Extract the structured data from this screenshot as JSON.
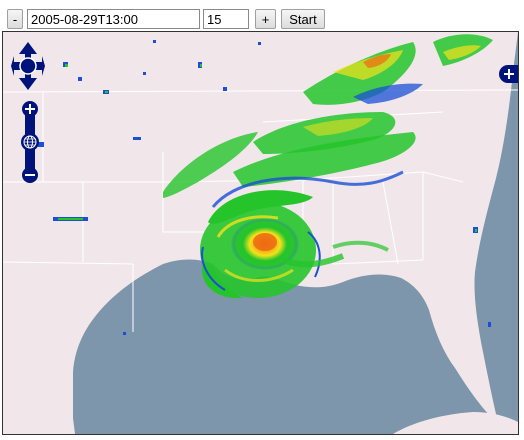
{
  "toolbar": {
    "step_back_label": "-",
    "time_value": "2005-08-29T13:00",
    "step_minutes_value": "15",
    "step_forward_label": "+",
    "start_label": "Start"
  },
  "map": {
    "layer": "radar reflectivity over southeastern United States",
    "colors": {
      "water": "#7d96ab",
      "land": "#f1e7ea",
      "borders": "#ffffff",
      "radar_low": "#1a4fd6",
      "radar_mid": "#25c42b",
      "radar_high": "#f2e21a",
      "radar_peak": "#ee6a12",
      "control_blue": "#00137a"
    },
    "controls": {
      "pan_icon": "pan-arrows-icon",
      "zoom_in_icon": "plus-icon",
      "zoom_world_icon": "globe-icon",
      "zoom_out_icon": "minus-icon",
      "layer_switcher_icon": "plus-circle-icon"
    }
  }
}
